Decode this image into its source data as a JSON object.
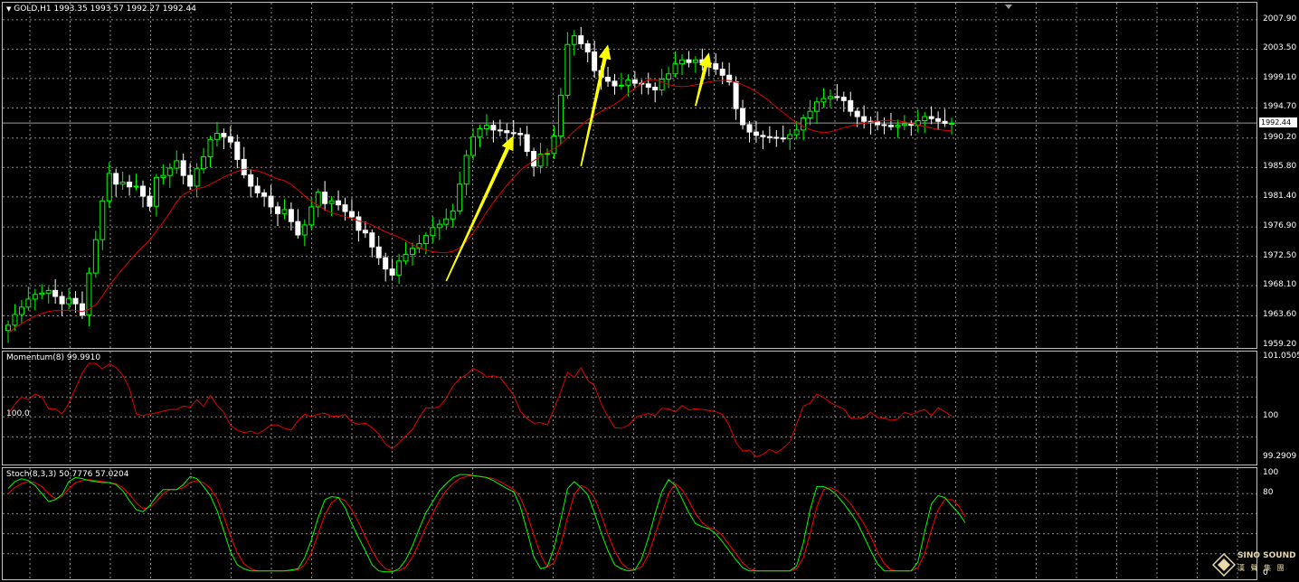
{
  "chart_data": [
    {
      "type": "candlestick",
      "title": "GOLD,H1 1993.35 1993.57 1992.27 1992.44",
      "symbol": "GOLD,H1",
      "ohlc_label": "1993.35 1993.57 1992.27 1992.44",
      "current_price_label": "1992.44",
      "current_price": 1992.44,
      "ylim": [
        1959.2,
        2009.5
      ],
      "ticks": [
        "2007.90",
        "2003.50",
        "1999.10",
        "1994.70",
        "1990.20",
        "1985.80",
        "1981.40",
        "1976.90",
        "1972.50",
        "1968.10",
        "1963.60",
        "1959.20"
      ],
      "tick_values": [
        2007.9,
        2003.5,
        1999.1,
        1994.7,
        1990.2,
        1985.8,
        1981.4,
        1976.9,
        1972.5,
        1968.1,
        1963.6,
        1959.2
      ],
      "close": [
        1962.2,
        1963.8,
        1964.9,
        1966.1,
        1966.8,
        1967.0,
        1967.4,
        1966.5,
        1965.4,
        1966.2,
        1965.4,
        1963.7,
        1970.0,
        1975.0,
        1980.8,
        1984.9,
        1983.3,
        1983.6,
        1982.9,
        1983.0,
        1981.5,
        1980.0,
        1984.3,
        1984.6,
        1985.7,
        1986.8,
        1984.6,
        1983.0,
        1985.6,
        1987.4,
        1990.0,
        1990.9,
        1990.4,
        1989.6,
        1987.0,
        1984.7,
        1983.0,
        1982.0,
        1981.5,
        1979.9,
        1978.9,
        1979.5,
        1977.7,
        1975.7,
        1977.2,
        1979.9,
        1982.1,
        1980.4,
        1980.8,
        1980.2,
        1979.2,
        1978.4,
        1976.4,
        1976.0,
        1973.9,
        1972.3,
        1970.6,
        1969.7,
        1971.8,
        1972.8,
        1973.7,
        1974.4,
        1975.6,
        1976.8,
        1977.3,
        1978.1,
        1979.3,
        1983.3,
        1987.6,
        1990.4,
        1991.6,
        1992.1,
        1991.4,
        1991.3,
        1991.0,
        1990.9,
        1990.7,
        1988.2,
        1986.0,
        1987.8,
        1987.9,
        1990.5,
        1996.6,
        2004.2,
        2005.5,
        2004.3,
        2003.1,
        2000.3,
        1999.3,
        1998.7,
        1998.0,
        1998.1,
        1998.9,
        1998.4,
        1998.3,
        1997.8,
        1997.4,
        1999.0,
        1999.8,
        2001.3,
        2001.9,
        2001.5,
        2001.9,
        2001.4,
        2001.3,
        2000.5,
        1999.6,
        1998.6,
        1994.6,
        1992.2,
        1991.1,
        1990.6,
        1990.4,
        1990.3,
        1990.2,
        1990.1,
        1990.7,
        1991.4,
        1993.2,
        1994.2,
        1995.6,
        1996.1,
        1996.4,
        1996.3,
        1995.8,
        1994.2,
        1993.4,
        1992.7,
        1992.6,
        1992.2,
        1992.1,
        1991.9,
        1992.1,
        1992.3,
        1992.1,
        1992.8,
        1993.4,
        1993.1,
        1992.7,
        1992.4,
        1992.4
      ],
      "momentum": {
        "label": "Momentum(8) 99.9910",
        "ylim": [
          99.2909,
          101.0505
        ],
        "ticks": [
          "101.0505",
          "100",
          "99.2909"
        ],
        "tick_values": [
          101.0505,
          100,
          99.2909
        ],
        "level_label": "100.0",
        "values": [
          100.05,
          100.22,
          100.35,
          100.3,
          100.4,
          100.35,
          100.14,
          100.14,
          100.05,
          100.24,
          100.5,
          100.77,
          100.94,
          100.94,
          100.84,
          100.93,
          100.87,
          100.73,
          100.5,
          100.05,
          100.02,
          100.05,
          100.07,
          100.1,
          100.13,
          100.13,
          100.19,
          100.17,
          100.3,
          100.18,
          100.38,
          100.2,
          100.08,
          99.85,
          99.77,
          99.72,
          99.75,
          99.7,
          99.77,
          99.86,
          99.86,
          99.8,
          99.77,
          99.93,
          100.05,
          100.0,
          100.05,
          100.06,
          100.01,
          100.01,
          100.04,
          99.91,
          99.87,
          99.89,
          99.81,
          99.7,
          99.52,
          99.44,
          99.55,
          99.67,
          99.78,
          99.99,
          100.16,
          100.15,
          100.18,
          100.33,
          100.54,
          100.67,
          100.74,
          100.85,
          100.79,
          100.7,
          100.72,
          100.69,
          100.54,
          100.38,
          100.1,
          99.97,
          99.89,
          99.9,
          99.86,
          100.14,
          100.44,
          100.78,
          100.69,
          100.86,
          100.64,
          100.55,
          100.23,
          100.0,
          99.81,
          99.8,
          99.85,
          99.98,
          100.03,
          100.06,
          100.02,
          100.15,
          100.14,
          100.09,
          100.2,
          100.12,
          100.14,
          100.13,
          100.11,
          100.09,
          100.04,
          99.85,
          99.55,
          99.4,
          99.42,
          99.3,
          99.34,
          99.43,
          99.37,
          99.45,
          99.56,
          99.87,
          100.19,
          100.24,
          100.4,
          100.34,
          100.25,
          100.19,
          100.14,
          99.98,
          99.97,
          99.99,
          100.08,
          99.99,
          99.98,
          99.94,
          99.96,
          100.08,
          100.04,
          100.09,
          100.13,
          100.02,
          100.16,
          100.09,
          100.01
        ]
      },
      "stochastic": {
        "label": "Stoch(8,3,3) 50.7776 57.0204",
        "ylim": [
          0,
          100
        ],
        "ticks": [
          "100",
          "80",
          "0"
        ],
        "tick_values": [
          100,
          80,
          0
        ],
        "main": [
          85,
          92,
          95,
          93,
          88,
          80,
          72,
          74,
          79,
          92,
          96,
          95,
          93,
          92,
          91,
          91,
          89,
          83,
          73,
          64,
          62,
          68,
          77,
          84,
          84,
          84,
          89,
          97,
          95,
          87,
          78,
          63,
          43,
          22,
          9,
          5,
          3,
          3,
          3,
          3,
          3,
          3,
          4,
          5,
          16,
          34,
          56,
          74,
          77,
          76,
          66,
          50,
          36,
          23,
          9,
          3,
          2,
          2,
          5,
          14,
          28,
          45,
          61,
          72,
          83,
          90,
          96,
          99,
          99,
          98,
          97,
          96,
          93,
          89,
          85,
          82,
          67,
          43,
          17,
          5,
          7,
          26,
          54,
          85,
          92,
          86,
          79,
          61,
          41,
          23,
          9,
          5,
          3,
          4,
          15,
          36,
          60,
          82,
          94,
          88,
          75,
          61,
          50,
          47,
          45,
          40,
          32,
          23,
          14,
          6,
          3,
          3,
          3,
          3,
          3,
          3,
          3,
          8,
          31,
          64,
          87,
          87,
          84,
          78,
          70,
          61,
          51,
          37,
          23,
          10,
          3,
          3,
          3,
          3,
          3,
          12,
          42,
          70,
          78,
          76,
          68,
          61,
          51
        ],
        "signal": [
          80,
          86,
          90,
          92,
          91,
          87,
          80,
          75,
          77,
          85,
          91,
          93,
          94,
          93,
          92,
          91,
          90,
          86,
          79,
          71,
          65,
          66,
          72,
          80,
          84,
          84,
          86,
          91,
          93,
          91,
          85,
          75,
          57,
          38,
          21,
          10,
          5,
          3,
          3,
          3,
          3,
          3,
          3,
          4,
          9,
          21,
          40,
          59,
          71,
          76,
          73,
          64,
          51,
          37,
          23,
          12,
          5,
          3,
          3,
          7,
          17,
          31,
          47,
          60,
          73,
          83,
          90,
          95,
          97,
          98,
          97,
          96,
          95,
          92,
          88,
          84,
          76,
          60,
          39,
          19,
          7,
          11,
          29,
          56,
          79,
          88,
          85,
          76,
          59,
          39,
          23,
          11,
          5,
          4,
          7,
          19,
          39,
          60,
          80,
          90,
          84,
          73,
          60,
          51,
          46,
          44,
          38,
          29,
          20,
          11,
          5,
          3,
          3,
          3,
          3,
          3,
          3,
          5,
          16,
          40,
          67,
          84,
          86,
          83,
          77,
          70,
          60,
          50,
          37,
          22,
          10,
          4,
          3,
          3,
          3,
          6,
          20,
          44,
          64,
          74,
          74,
          68,
          57
        ]
      }
    }
  ],
  "logo": {
    "line1": "SINO SOUND",
    "line2": "漢 聲 集 團"
  },
  "colors": {
    "bull": "#00ff00",
    "bear": "#ffffff",
    "ma": "#e00000",
    "grid": "#8a8a8a",
    "arrow": "#ffff00",
    "stoch_main": "#00ff00",
    "stoch_signal": "#ff0000",
    "momentum": "#e00000"
  }
}
